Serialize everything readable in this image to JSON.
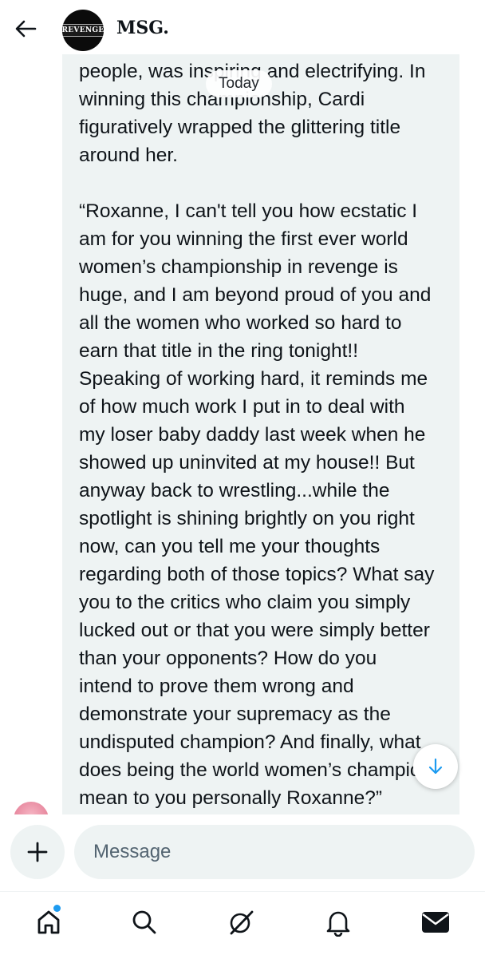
{
  "header": {
    "title": "MSG.",
    "avatar_logo_text": "REVENGE"
  },
  "chat": {
    "date_separator": "Today",
    "message_text": "people, was inspiring and electrifying. In\nwinning this championship, Cardi\nfiguratively wrapped the glittering title\naround her.\n\n“Roxanne, I can't tell you how ecstatic I\nam for you winning the first ever world\nwomen’s championship in revenge is\nhuge, and I am beyond proud of you and\nall the women who worked so hard to\nearn that title in the ring tonight!!\nSpeaking of working hard, it reminds me\nof how much work I put in to deal with\nmy loser baby daddy last week when he\nshowed up uninvited at my house!! But\nanyway back to wrestling...while the\nspotlight is shining brightly on you right\nnow, can you tell me your thoughts\nregarding both of those topics? What say\nyou to the critics who claim you simply\nlucked out or that you were simply better\nthan your opponents? How do you\nintend to prove them wrong and\ndemonstrate your supremacy as the\nundisputed champion? And finally, what\ndoes being the world women’s champion\nmean to you personally Roxanne?”"
  },
  "composer": {
    "placeholder": "Message"
  },
  "nav": {
    "items": [
      "home-icon",
      "search-icon",
      "grok-icon",
      "notifications-icon",
      "messages-icon"
    ],
    "notification_dot_color": "#1d9bf0"
  },
  "colors": {
    "bubble_bg": "#eef3f3",
    "accent": "#1d9bf0",
    "text": "#0f1419"
  }
}
